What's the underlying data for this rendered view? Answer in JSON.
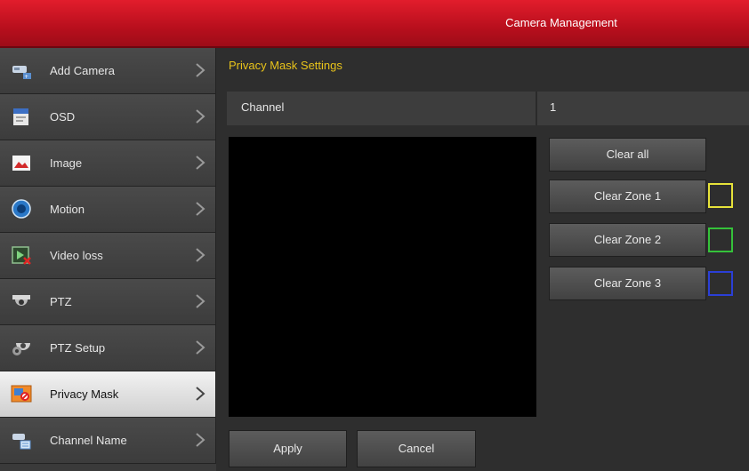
{
  "window": {
    "title": "Camera Management"
  },
  "sidebar": {
    "items": [
      {
        "label": "Add Camera",
        "icon": "camera-add-icon"
      },
      {
        "label": "OSD",
        "icon": "osd-icon"
      },
      {
        "label": "Image",
        "icon": "image-icon"
      },
      {
        "label": "Motion",
        "icon": "motion-icon"
      },
      {
        "label": "Video loss",
        "icon": "video-loss-icon"
      },
      {
        "label": "PTZ",
        "icon": "ptz-icon"
      },
      {
        "label": "PTZ Setup",
        "icon": "ptz-setup-icon"
      },
      {
        "label": "Privacy Mask",
        "icon": "privacy-mask-icon",
        "active": true
      },
      {
        "label": "Channel Name",
        "icon": "channel-name-icon"
      }
    ]
  },
  "main": {
    "section_title": "Privacy Mask Settings",
    "channel": {
      "label": "Channel",
      "value": "1"
    },
    "clear_all_label": "Clear all",
    "zones": [
      {
        "label": "Clear Zone 1",
        "color": "#e6e23a"
      },
      {
        "label": "Clear Zone 2",
        "color": "#35c23a"
      },
      {
        "label": "Clear Zone 3",
        "color": "#2b3fd6"
      }
    ],
    "apply_label": "Apply",
    "cancel_label": "Cancel"
  },
  "colors": {
    "accent": "#c8101e",
    "section_title": "#e8c31a"
  }
}
